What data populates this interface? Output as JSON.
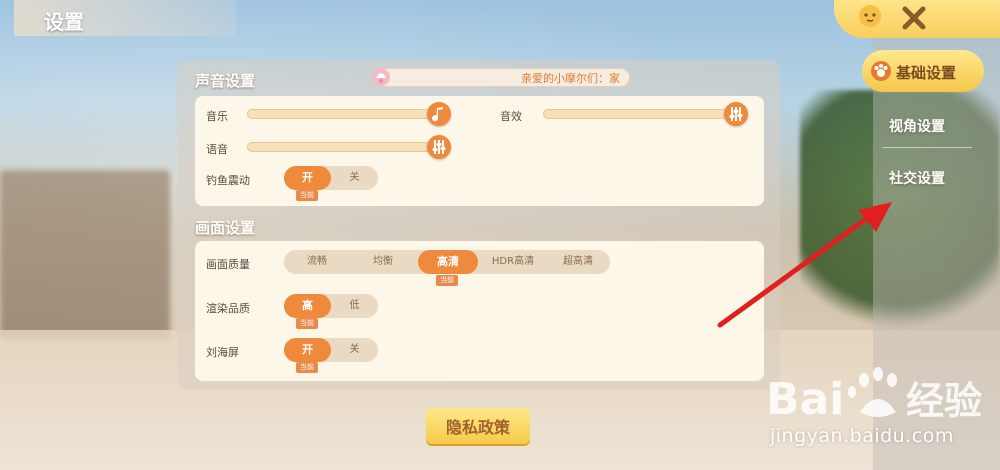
{
  "header": {
    "title": "设置"
  },
  "sound": {
    "section_title": "声音设置",
    "ticker_text": "亲爱的小摩尔们：家",
    "music_label": "音乐",
    "effects_label": "音效",
    "voice_label": "语音",
    "fishing_vibration_label": "钓鱼震动",
    "music_level": 1.0,
    "effects_level": 1.0,
    "voice_level": 1.0,
    "vibration_options": [
      "开",
      "关"
    ],
    "vibration_selected": "开",
    "current_tag": "当前"
  },
  "display": {
    "section_title": "画面设置",
    "quality_label": "画面质量",
    "quality_options": [
      "流畅",
      "均衡",
      "高清",
      "HDR高清",
      "超高清"
    ],
    "quality_selected": "高清",
    "render_label": "渲染品质",
    "render_options": [
      "高",
      "低"
    ],
    "render_selected": "高",
    "notch_label": "刘海屏",
    "notch_options": [
      "开",
      "关"
    ],
    "notch_selected": "开",
    "current_tag": "当前"
  },
  "footer": {
    "privacy_button": "隐私政策"
  },
  "sidebar": {
    "items": [
      {
        "label": "基础设置",
        "active": true,
        "icon": "pet-paw-icon"
      },
      {
        "label": "视角设置",
        "active": false
      },
      {
        "label": "社交设置",
        "active": false
      }
    ],
    "close_icon": "close-icon"
  },
  "watermark": {
    "brand": "Bai经验",
    "url": "jingyan.baidu.com"
  },
  "colors": {
    "accent": "#ef8a3c",
    "tab_yellow": "#f8cf5b",
    "card_bg": "#fdf7ea",
    "arrow": "#e0201e"
  }
}
